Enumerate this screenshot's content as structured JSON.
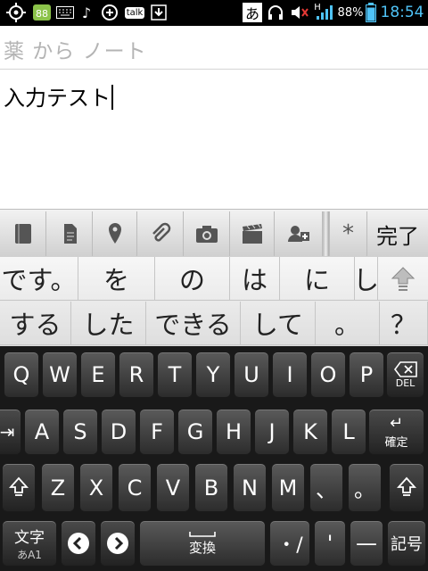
{
  "status_bar": {
    "badge_count": "88",
    "talk_label": "talk",
    "ime_mode": "あ",
    "network_type": "H",
    "battery_percent": "88%",
    "time": "18:54",
    "battery_level": 0.88
  },
  "note": {
    "title_placeholder": "薬 から ノート",
    "body_text": "入力テスト"
  },
  "toolbar": {
    "asterisk_label": "*",
    "done_label": "完了"
  },
  "suggestions": {
    "row1": [
      "です。",
      "を",
      "の",
      "は",
      "に",
      "し"
    ],
    "row2": [
      "する",
      "した",
      "できる",
      "して",
      "。",
      "？"
    ]
  },
  "keyboard": {
    "row1": [
      "Q",
      "W",
      "E",
      "R",
      "T",
      "Y",
      "U",
      "I",
      "O",
      "P"
    ],
    "row2": [
      "A",
      "S",
      "D",
      "F",
      "G",
      "H",
      "J",
      "K",
      "L"
    ],
    "row3": [
      "Z",
      "X",
      "C",
      "V",
      "B",
      "N",
      "M",
      "、",
      "。"
    ],
    "del_label": "DEL",
    "confirm_label": "確定",
    "mode_label": "文字",
    "mode_sub_label": "あA1",
    "convert_label": "変換",
    "dot_slash_label": "・/",
    "quote_label": "'",
    "dash_label": "—",
    "symbol_label": "記号"
  }
}
